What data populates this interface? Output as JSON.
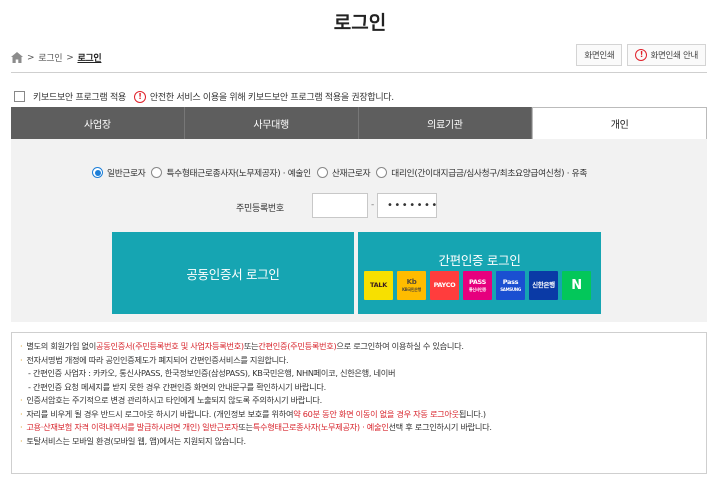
{
  "page": {
    "title": "로그인"
  },
  "breadcrumb": {
    "items": [
      "로그인"
    ],
    "current": "로그인",
    "sep": ">"
  },
  "print": {
    "print_label": "화면인쇄",
    "print_guide_label": "화면인쇄 안내"
  },
  "keyboard": {
    "checkbox_label": "키보드보안 프로그램 적용",
    "notice": "안전한 서비스 이용을 위해 키보드보안 프로그램 적용을 권장합니다."
  },
  "tabs": [
    {
      "label": "사업장"
    },
    {
      "label": "사무대행"
    },
    {
      "label": "의료기관"
    },
    {
      "label": "개인",
      "active": true
    }
  ],
  "radios": [
    {
      "label": "일반근로자",
      "checked": true
    },
    {
      "label": "특수형태근로종사자(노무제공자) · 예술인",
      "checked": false
    },
    {
      "label": "산재근로자",
      "checked": false
    },
    {
      "label": "대리인(간이대지급금/심사청구/최초요양급여신청) · 유족",
      "checked": false
    }
  ],
  "rrn": {
    "label": "주민등록번호",
    "front_value": "",
    "dash": "-",
    "back_value": "•••••••"
  },
  "cert_login": {
    "label": "공동인증서 로그인"
  },
  "simple_login": {
    "title": "간편인증 로그인",
    "providers": [
      {
        "name": "TALK",
        "color": "#f7e000",
        "text_color": "#3c1e1e"
      },
      {
        "name": "Kb",
        "sub": "KB국민은행",
        "color": "#ffbc00",
        "text_color": "#574b35"
      },
      {
        "name": "PAYCO",
        "color": "#ff3d3d",
        "text_color": "#ffffff"
      },
      {
        "name": "PASS",
        "sub": "통신사인증",
        "color": "#e6007e",
        "text_color": "#ffffff"
      },
      {
        "name": "Pass",
        "sub": "SAMSUNG",
        "color": "#1a4fd1",
        "text_color": "#ffffff"
      },
      {
        "name": "신한은행",
        "color": "#0a3aa6",
        "text_color": "#ffffff"
      },
      {
        "name": "N",
        "color": "#03c75a",
        "text_color": "#ffffff"
      }
    ]
  },
  "notice": {
    "bullet": "·",
    "l1_a": "별도의 회원가입 없이 ",
    "l1_b": "공동인증서(주민등록번호 및 사업자등록번호)",
    "l1_c": " 또는 ",
    "l1_d": "간편인증(주민등록번호)",
    "l1_e": "으로 로그인하여 이용하실 수 있습니다.",
    "l2": "전자서명법 개정에 따라 공인인증제도가 폐지되어 간편인증서비스를 지원합니다.",
    "l3": "- 간편인증 사업자 : 카카오, 통신사PASS, 한국정보인증(삼성PASS), KB국민은행, NHN페이코, 신한은행, 네이버",
    "l4": "- 간편인증 요청 메세지를 받지 못한 경우 간편인증 화면의 안내문구를 확인하시기 바랍니다.",
    "l5": "인증서암호는 주기적으로 변경 관리하시고 타인에게 노출되지 않도록 주의하시기 바랍니다.",
    "l6_a": "자리를 비우게 될 경우 반드시 로그아웃 하시기 바랍니다. (개인정보 보호를 위하여 ",
    "l6_b": "약 60분 동안 화면 이동이 없을 경우 자동 로그아웃",
    "l6_c": "됩니다.)",
    "l7_a": "고용·산재보험 자격 이력내역서를 발급하시려면 개인) 일반근로자",
    "l7_b": " 또는 ",
    "l7_c": "특수형태근로종사자(노무제공자) · 예술인",
    "l7_d": " 선택 후 로그인하시기 바랍니다.",
    "l8": "토탈서비스는 모바일 환경(모바일 웹, 앱)에서는 지원되지 않습니다."
  }
}
